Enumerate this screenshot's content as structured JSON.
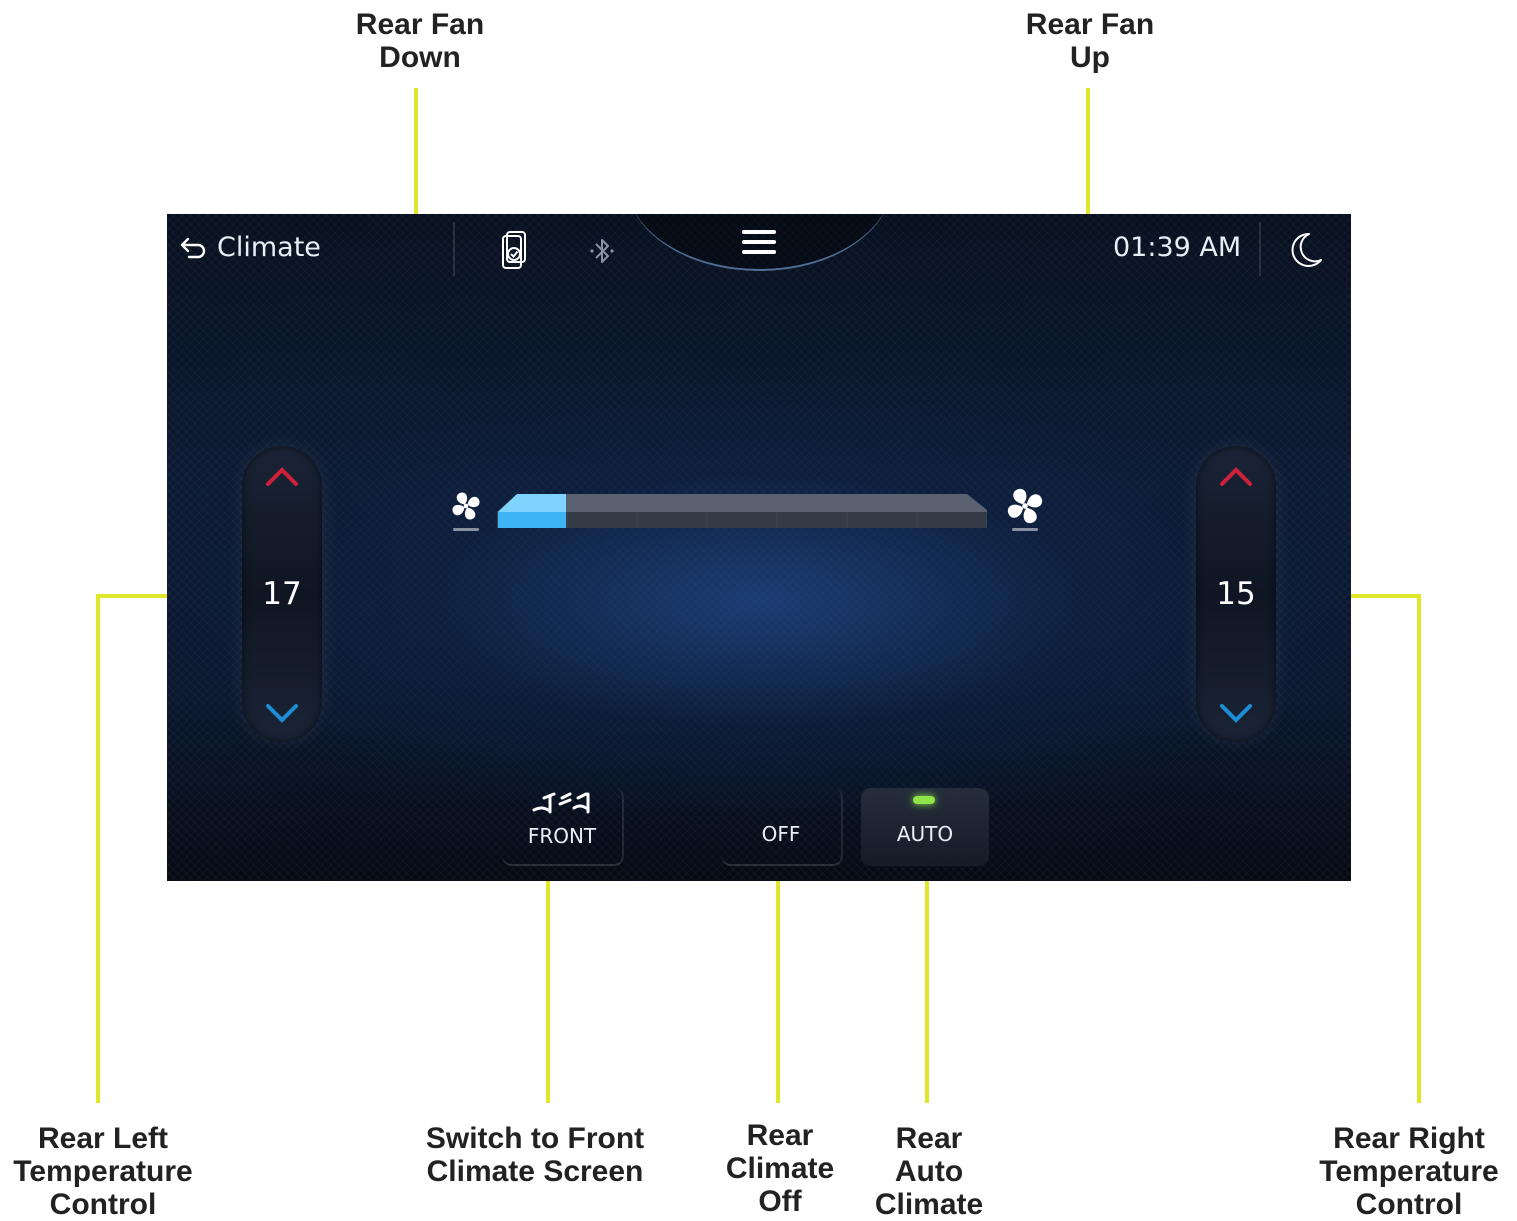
{
  "colors": {
    "callout_line": "#e0e62a",
    "temp_up": "#d0203a",
    "temp_down": "#1e8fd6",
    "fan_active": "#3fb4f5",
    "auto_led": "#8ee64a"
  },
  "header": {
    "back_label": "Climate",
    "time": "01:39 AM",
    "icons": [
      "back-arrow-icon",
      "phone-projection-icon",
      "bluetooth-icon",
      "menu-icon",
      "moon-icon"
    ]
  },
  "left_temp": {
    "value": "17"
  },
  "right_temp": {
    "value": "15"
  },
  "fan": {
    "level": 1,
    "max_level": 7,
    "icons": [
      "fan-icon"
    ]
  },
  "buttons": {
    "front": "FRONT",
    "off": "OFF",
    "auto": "AUTO"
  },
  "callouts": {
    "fan_down": [
      "Rear Fan",
      "Down"
    ],
    "fan_up": [
      "Rear Fan",
      "Up"
    ],
    "left_temp": [
      "Rear Left",
      "Temperature",
      "Control"
    ],
    "front": [
      "Switch to Front",
      "Climate Screen"
    ],
    "off": [
      "Rear",
      "Climate",
      "Off"
    ],
    "auto": [
      "Rear",
      "Auto",
      "Climate"
    ],
    "right_temp": [
      "Rear Right",
      "Temperature",
      "Control"
    ]
  }
}
